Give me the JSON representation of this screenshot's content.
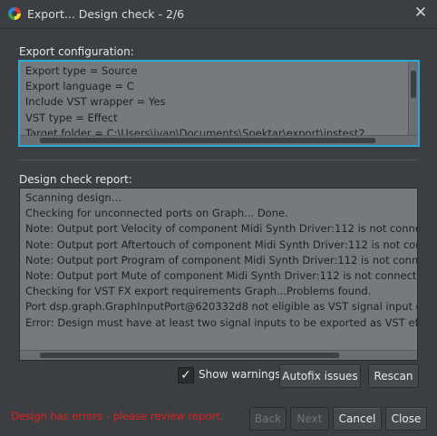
{
  "window": {
    "title": "Export... Design check - 2/6",
    "close_glyph": "✕",
    "app_icon": "app-logo-icon"
  },
  "config": {
    "label": "Export configuration:",
    "lines": [
      "Export type = Source",
      "Export language = C",
      "Include VST wrapper = Yes",
      "VST type = Effect",
      "Target folder = C:\\Users\\ivan\\Documents\\Spektar\\export\\instest2"
    ]
  },
  "report": {
    "label": "Design check report:",
    "lines": [
      "Scanning design...",
      "Checking for unconnected ports on Graph... Done.",
      "Note: Output port Velocity of component Midi Synth Driver:112 is not connected.",
      "Note: Output port Aftertouch of component Midi Synth Driver:112 is not connected.",
      "Note: Output port Program of component Midi Synth Driver:112 is not connected.",
      "Note: Output port Mute of component Midi Synth Driver:112 is not connected.",
      "Checking for VST FX export requirements Graph...Problems found.",
      "Port dsp.graph.GraphInputPort@620332d8 not eligible as VST signal input due to",
      "Error: Design must have at least two signal inputs to be exported as VST effect (fo"
    ]
  },
  "controls": {
    "show_warnings_label": "Show warnings",
    "show_warnings_checked": true,
    "checkmark_glyph": "✓",
    "autofix_label": "Autofix issues",
    "rescan_label": "Rescan"
  },
  "footer": {
    "status": "Design has errors - please review report.",
    "back_label": "Back",
    "next_label": "Next",
    "cancel_label": "Cancel",
    "close_label": "Close"
  },
  "colors": {
    "background": "#3c3f41",
    "text_area": "#767a7e",
    "focus_border": "#2aa8d8",
    "error_text": "#e02020"
  }
}
